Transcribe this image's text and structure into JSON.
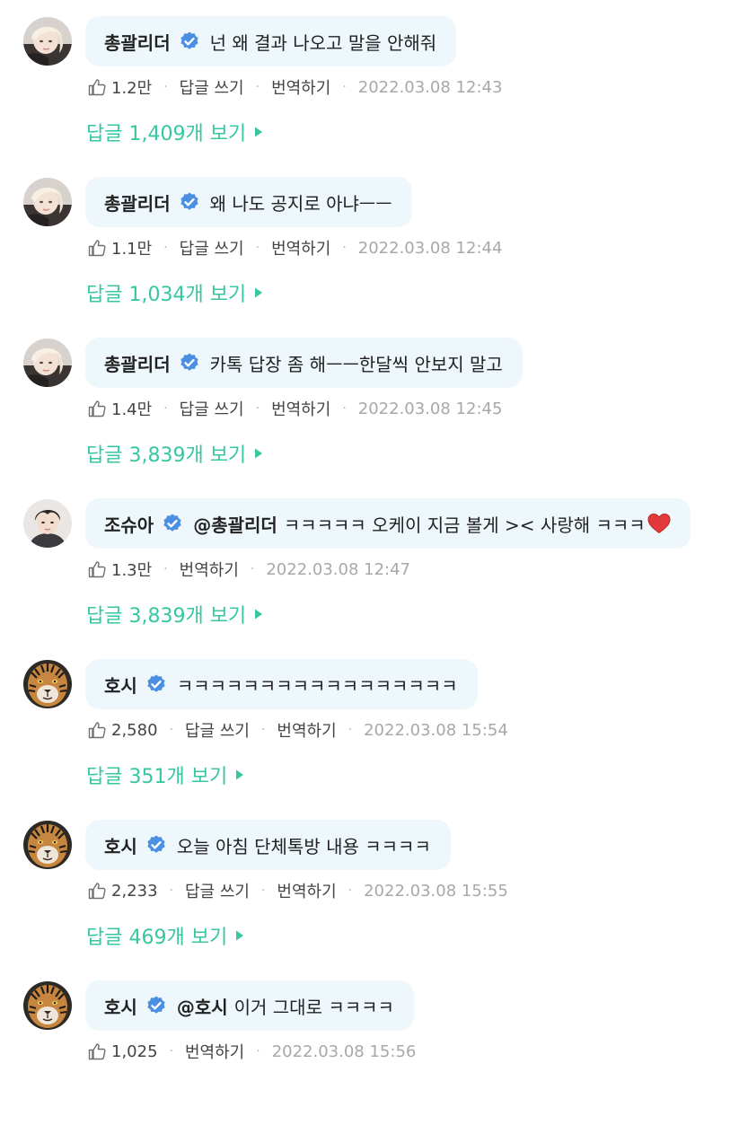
{
  "colors": {
    "accent": "#37c7a0",
    "bubble": "#eef7fb",
    "verified": "#4a8fe2",
    "heart": "#e23a3a"
  },
  "icons": {
    "verified": "verified-badge-icon",
    "like": "thumbs-up-icon",
    "replies": "caret-right-icon",
    "heart": "red-heart-icon"
  },
  "comments": [
    {
      "avatar": "avatar-blonde",
      "author": "총괄리더",
      "mention": "",
      "text": "넌 왜 결과 나오고 말을 안해줘",
      "heart": false,
      "likes": "1.2만",
      "reply_action": "답글 쓰기",
      "translate": "번역하기",
      "timestamp": "2022.03.08 12:43",
      "replies": "답글 1,409개 보기"
    },
    {
      "avatar": "avatar-blonde",
      "author": "총괄리더",
      "mention": "",
      "text": "왜 나도 공지로 아냐ㅡㅡ",
      "heart": false,
      "likes": "1.1만",
      "reply_action": "답글 쓰기",
      "translate": "번역하기",
      "timestamp": "2022.03.08 12:44",
      "replies": "답글 1,034개 보기"
    },
    {
      "avatar": "avatar-blonde",
      "author": "총괄리더",
      "mention": "",
      "text": "카톡 답장 좀 해ㅡㅡ한달씩 안보지 말고",
      "heart": false,
      "likes": "1.4만",
      "reply_action": "답글 쓰기",
      "translate": "번역하기",
      "timestamp": "2022.03.08 12:45",
      "replies": "답글 3,839개 보기"
    },
    {
      "avatar": "avatar-darkhair",
      "author": "조슈아",
      "mention": "@총괄리더",
      "text": "ㅋㅋㅋㅋㅋ 오케이 지금 볼게 >< 사랑해 ㅋㅋㅋ",
      "heart": true,
      "likes": "1.3만",
      "reply_action": "",
      "translate": "번역하기",
      "timestamp": "2022.03.08 12:47",
      "replies": "답글 3,839개 보기"
    },
    {
      "avatar": "avatar-tiger",
      "author": "호시",
      "mention": "",
      "text": "ㅋㅋㅋㅋㅋㅋㅋㅋㅋㅋㅋㅋㅋㅋㅋㅋㅋ",
      "heart": false,
      "likes": "2,580",
      "reply_action": "답글 쓰기",
      "translate": "번역하기",
      "timestamp": "2022.03.08 15:54",
      "replies": "답글 351개 보기"
    },
    {
      "avatar": "avatar-tiger",
      "author": "호시",
      "mention": "",
      "text": "오늘 아침 단체톡방 내용 ㅋㅋㅋㅋ",
      "heart": false,
      "likes": "2,233",
      "reply_action": "답글 쓰기",
      "translate": "번역하기",
      "timestamp": "2022.03.08 15:55",
      "replies": "답글 469개 보기"
    },
    {
      "avatar": "avatar-tiger",
      "author": "호시",
      "mention": "@호시",
      "text": "이거 그대로 ㅋㅋㅋㅋ",
      "heart": false,
      "likes": "1,025",
      "reply_action": "",
      "translate": "번역하기",
      "timestamp": "2022.03.08 15:56",
      "replies": ""
    }
  ]
}
